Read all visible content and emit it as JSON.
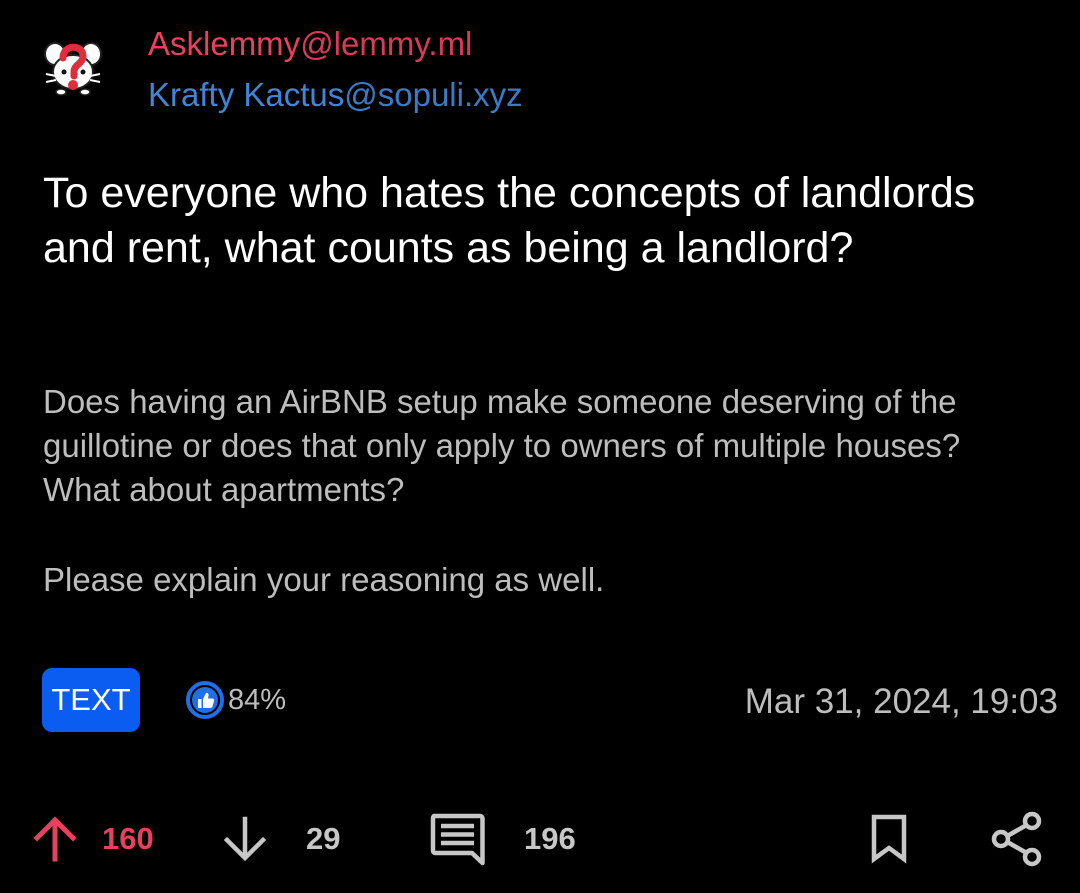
{
  "post": {
    "community": {
      "name": "Asklemmy",
      "host": "@lemmy.ml"
    },
    "author": {
      "name": "Krafty Kactus",
      "host": "@sopuli.xyz"
    },
    "title": "To everyone who hates the concepts of landlords and rent, what counts as being a landlord?",
    "body": [
      "Does having an AirBNB setup make someone deserving of the guillotine or does that only apply to owners of multiple houses? What about apartments?",
      "Please explain your reasoning as well."
    ],
    "type_badge": "TEXT",
    "upvote_ratio": "84%",
    "timestamp": "Mar 31, 2024, 19:03"
  },
  "actions": {
    "upvotes": "160",
    "downvotes": "29",
    "comments": "196"
  },
  "icons": {
    "avatar": "asklemmy-logo-icon",
    "ratio": "thumbs-up-icon",
    "upvote": "arrow-up-icon",
    "downvote": "arrow-down-icon",
    "comments": "comment-icon",
    "bookmark": "bookmark-icon",
    "share": "share-icon"
  },
  "colors": {
    "background": "#000000",
    "community": "#e8405f",
    "author": "#3f85d9",
    "badge": "#0b5cf0",
    "upvote": "#e8405f",
    "muted": "#bdbdbd"
  }
}
